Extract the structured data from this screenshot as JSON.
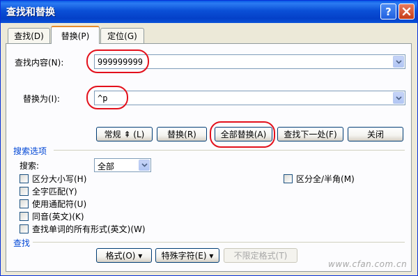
{
  "window": {
    "title": "查找和替换"
  },
  "tabs": [
    {
      "label": "查找(D)"
    },
    {
      "label": "替换(P)"
    },
    {
      "label": "定位(G)"
    }
  ],
  "find": {
    "label": "查找内容(N):",
    "value": "999999999"
  },
  "replace": {
    "label": "替换为(I):",
    "value": "^p"
  },
  "buttons": {
    "normal": "常规 ⇞ (L)",
    "replace": "替换(R)",
    "replace_all": "全部替换(A)",
    "find_next": "查找下一处(F)",
    "close": "关闭"
  },
  "search_options": {
    "title": "搜索选项",
    "search_label": "搜索:",
    "search_value": "全部",
    "checkboxes": [
      {
        "label": "区分大小写(H)",
        "checked": false
      },
      {
        "label": "全字匹配(Y)",
        "checked": false
      },
      {
        "label": "使用通配符(U)",
        "checked": false
      },
      {
        "label": "同音(英文)(K)",
        "checked": false
      },
      {
        "label": "查找单词的所有形式(英文)(W)",
        "checked": false
      }
    ],
    "fullwidth": {
      "label": "区分全/半角(M)",
      "checked": false
    }
  },
  "find_section": {
    "title": "查找",
    "format": "格式(O) ▾",
    "special": "特殊字符(E) ▾",
    "no_format": "不限定格式(T)"
  },
  "watermark": "www.cfan.com.cn",
  "highlight_color": "#e3101b"
}
